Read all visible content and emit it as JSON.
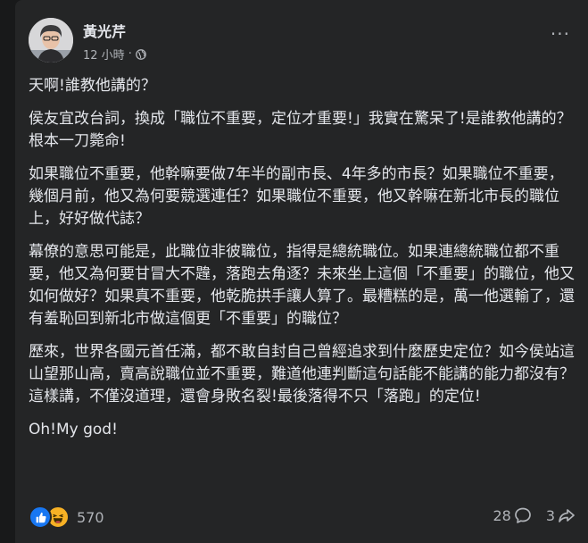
{
  "post": {
    "author": "黃光芹",
    "time": "12 小時",
    "separator": "·",
    "more_label": "···",
    "paragraphs": [
      "天啊!誰教他講的？",
      "侯友宜改台詞，換成「職位不重要，定位才重要!」我實在驚呆了!是誰教他講的？根本一刀斃命!",
      "如果職位不重要，他幹嘛要做7年半的副市長、4年多的市長？如果職位不重要，幾個月前，他又為何要競選連任？如果職位不重要，他又幹嘛在新北市長的職位上，好好做代誌？",
      "幕僚的意思可能是，此職位非彼職位，指得是總統職位。如果連總統職位都不重要，他又為何要甘冒大不韙，落跑去角逐？未來坐上這個「不重要」的職位，他又如何做好？如果真不重要，他乾脆拱手讓人算了。最糟糕的是，萬一他選輸了，還有羞恥回到新北市做這個更「不重要」的職位？",
      "歷來，世界各國元首任滿，都不敢自封自己曾經追求到什麼歷史定位？如今侯站這山望那山高，賣高說職位並不重要，難道他連判斷這句話能不能講的能力都沒有？這樣講，不僅沒道理，還會身敗名裂!最後落得不只「落跑」的定位!",
      "Oh!My god!"
    ]
  },
  "footer": {
    "reaction_count": "570",
    "comments_count": "28",
    "shares_count": "3"
  },
  "colors": {
    "card_bg": "#242526",
    "page_bg": "#18191a",
    "text": "#e4e6eb",
    "secondary": "#b0b3b8",
    "like_blue": "#1877f2",
    "haha_yellow": "#f7b125"
  }
}
